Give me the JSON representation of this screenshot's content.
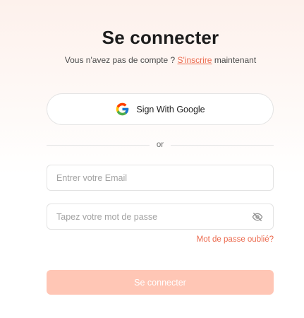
{
  "header": {
    "title": "Se connecter",
    "signup_prefix": "Vous n'avez pas de compte ? ",
    "signup_link": "S'inscrire",
    "signup_suffix": " maintenant"
  },
  "google": {
    "label": "Sign With Google",
    "icon": "google-logo-icon"
  },
  "divider": {
    "text": "or"
  },
  "form": {
    "email_placeholder": "Entrer votre Email",
    "email_value": "",
    "password_placeholder": "Tapez votre mot de passe",
    "password_value": "",
    "password_toggle_icon": "eye-off-icon",
    "forgot_label": "Mot de passe oublié?",
    "submit_label": "Se connecter"
  },
  "colors": {
    "accent": "#ec6a4e",
    "submit_disabled": "#ffc6b5",
    "border": "#e3e3e3"
  }
}
